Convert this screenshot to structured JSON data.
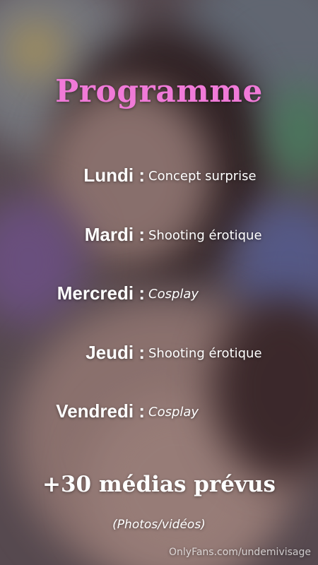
{
  "title": "Programme",
  "schedule": [
    {
      "day": "Lundi :",
      "activity": "Concept surprise"
    },
    {
      "day": "Mardi :",
      "activity": "Shooting érotique"
    },
    {
      "day": "Mercredi :",
      "activity": "Cosplay"
    },
    {
      "day": "Jeudi :",
      "activity": "Shooting érotique"
    },
    {
      "day": "Vendredi :",
      "activity": "Cosplay"
    }
  ],
  "medias": "+30 médias prévus",
  "medias_note": "(Photos/vidéos)",
  "watermark": "OnlyFans.com/undemivisage",
  "colors": {
    "title": "#f07ad8",
    "text": "#ffffff"
  }
}
